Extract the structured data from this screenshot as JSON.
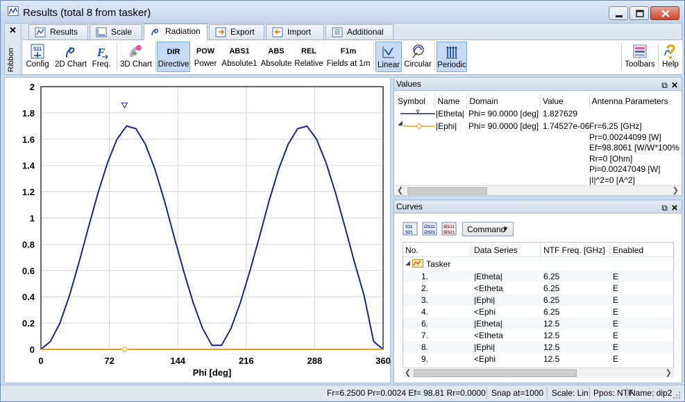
{
  "window": {
    "title": "Results (total 8 from tasker)"
  },
  "ribbon": {
    "close_label": "✕",
    "side_label": "Ribbon",
    "tabs": [
      {
        "label": "Results",
        "icon": "results-icon"
      },
      {
        "label": "Scale",
        "icon": "scale-icon"
      },
      {
        "label": "Radiation",
        "icon": "radiation-icon",
        "active": true
      },
      {
        "label": "Export",
        "icon": "export-icon"
      },
      {
        "label": "Import",
        "icon": "import-icon"
      },
      {
        "label": "Additional",
        "icon": "additional-icon"
      }
    ],
    "buttons": {
      "config": {
        "label": "Config",
        "glyph": "S11"
      },
      "chart2d": {
        "label": "2D Chart"
      },
      "freq": {
        "label": "Freq.",
        "glyph": "F"
      },
      "chart3d": {
        "label": "3D Chart"
      },
      "directive": {
        "label": "Directive",
        "glyph": "DIR",
        "selected": true
      },
      "power": {
        "label": "Power",
        "glyph": "POW"
      },
      "absolute1": {
        "label": "Absolute1",
        "glyph": "ABS1"
      },
      "absolute": {
        "label": "Absolute",
        "glyph": "ABS"
      },
      "relative": {
        "label": "Relative",
        "glyph": "REL"
      },
      "fields1m": {
        "label": "Fields at 1m",
        "glyph": "F1m"
      },
      "linear": {
        "label": "Linear",
        "selected": true
      },
      "circular": {
        "label": "Circular"
      },
      "periodic": {
        "label": "Periodic",
        "selected": true
      },
      "toolbars": {
        "label": "Toolbars"
      },
      "help": {
        "label": "Help"
      }
    }
  },
  "chart_data": {
    "type": "line",
    "xlabel": "Phi [deg]",
    "ylabel": "",
    "xlim": [
      0,
      360
    ],
    "ylim": [
      0,
      2
    ],
    "x_ticks": [
      "0",
      "72",
      "144",
      "216",
      "288",
      "360"
    ],
    "y_ticks": [
      "0",
      "0.2",
      "0.4",
      "0.6",
      "0.8",
      "1",
      "1.2",
      "1.4",
      "1.6",
      "1.8",
      "2"
    ],
    "grid": true,
    "series": [
      {
        "name": "|Etheta|",
        "color": "#1a237e",
        "x": [
          0,
          10,
          20,
          30,
          40,
          50,
          60,
          70,
          80,
          90,
          100,
          110,
          120,
          130,
          140,
          150,
          160,
          170,
          180,
          190,
          200,
          210,
          220,
          230,
          240,
          250,
          260,
          270,
          280,
          290,
          300,
          310,
          320,
          330,
          340,
          350,
          360
        ],
        "values": [
          0,
          0.06,
          0.2,
          0.41,
          0.66,
          0.93,
          1.19,
          1.42,
          1.6,
          1.7,
          1.68,
          1.56,
          1.37,
          1.13,
          0.86,
          0.6,
          0.36,
          0.16,
          0.03,
          0.03,
          0.16,
          0.36,
          0.6,
          0.86,
          1.13,
          1.37,
          1.56,
          1.68,
          1.7,
          1.6,
          1.42,
          1.19,
          0.93,
          0.66,
          0.41,
          0.06,
          0
        ]
      },
      {
        "name": "|Ephi|",
        "color": "#e8a317",
        "x": [
          0,
          360
        ],
        "values": [
          0,
          0
        ]
      }
    ],
    "markers": [
      {
        "series": "|Etheta|",
        "x": 88,
        "y": 1.827629,
        "shape": "triangle-down"
      },
      {
        "series": "|Ephi|",
        "x": 88,
        "y": 0,
        "shape": "diamond"
      }
    ]
  },
  "values_panel": {
    "title": "Values",
    "columns": [
      "Symbol",
      "Name",
      "Domain",
      "Value",
      "Antenna Parameters"
    ],
    "rows": [
      {
        "symbol": "line-marker-v",
        "name": "|Etheta|",
        "domain": "Phi= 90.0000 [deg]",
        "value": "1.827629"
      },
      {
        "symbol": "line-marker-diamond",
        "name": "|Ephi|",
        "domain": "Phi= 90.0000 [deg]",
        "value": "1.74527e-06"
      }
    ],
    "antenna_params": [
      "Fr=6.25 [GHz]",
      "Pr=0.00244099 [W]",
      "Ef=98.8061 [W/W*100%]",
      "Rr=0 [Ohm]",
      "Pi=0.00247049 [W]",
      "|I|^2=0 [A^2]"
    ]
  },
  "curves_panel": {
    "title": "Curves",
    "command_label": "Command",
    "columns": [
      "No.",
      "Data Series",
      "NTF Freq. [GHz]",
      "Enabled"
    ],
    "group": "Tasker",
    "rows": [
      {
        "no": "1.",
        "series": "|Etheta|",
        "freq": "6.25",
        "enabled": "E"
      },
      {
        "no": "2.",
        "series": "<Etheta",
        "freq": "6.25",
        "enabled": "E"
      },
      {
        "no": "3.",
        "series": "|Ephi|",
        "freq": "6.25",
        "enabled": "E"
      },
      {
        "no": "4.",
        "series": "<Ephi",
        "freq": "6.25",
        "enabled": "E"
      },
      {
        "no": "6.",
        "series": "|Etheta|",
        "freq": "12.5",
        "enabled": "E"
      },
      {
        "no": "7.",
        "series": "<Etheta",
        "freq": "12.5",
        "enabled": "E"
      },
      {
        "no": "8.",
        "series": "|Ephi|",
        "freq": "12.5",
        "enabled": "E"
      },
      {
        "no": "9.",
        "series": "<Ephi",
        "freq": "12.5",
        "enabled": "E"
      }
    ]
  },
  "statusbar": {
    "params": "Fr=6.2500 Pr=0.0024 Ef= 98.81 Rr=0.0000",
    "snap": "Snap at=1000",
    "scale": "Scale: Lin.",
    "ppos": "Ppos: NTF",
    "name": "Name: dip2"
  }
}
